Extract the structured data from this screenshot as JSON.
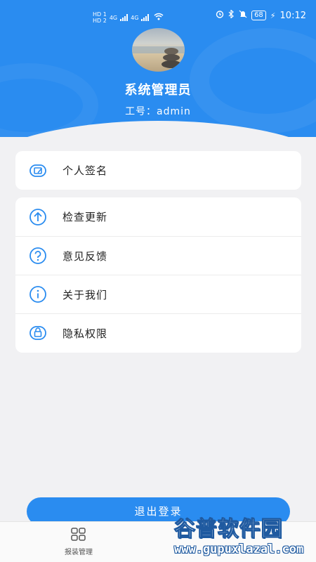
{
  "status_bar": {
    "sim1": "HD 1",
    "sim2": "HD 2",
    "net1": "4G",
    "net2": "4G",
    "battery": "68",
    "time": "10:12"
  },
  "profile": {
    "name": "系统管理员",
    "employee_no": "工号：admin"
  },
  "menu_top": [
    {
      "label": "个人签名",
      "icon": "signature-icon"
    }
  ],
  "menu_main": [
    {
      "label": "检查更新",
      "icon": "arrow-up-circle-icon"
    },
    {
      "label": "意见反馈",
      "icon": "question-circle-icon"
    },
    {
      "label": "关于我们",
      "icon": "info-circle-icon"
    },
    {
      "label": "隐私权限",
      "icon": "lock-icon"
    }
  ],
  "logout_label": "退出登录",
  "tabbar": {
    "tab1_label": "报装管理",
    "tab1_icon": "grid-icon"
  },
  "watermark": {
    "line1": "谷普软件园",
    "line2": "www.gupuxlazal.com"
  },
  "colors": {
    "primary": "#2a8cf0",
    "background": "#f1f1f3"
  }
}
